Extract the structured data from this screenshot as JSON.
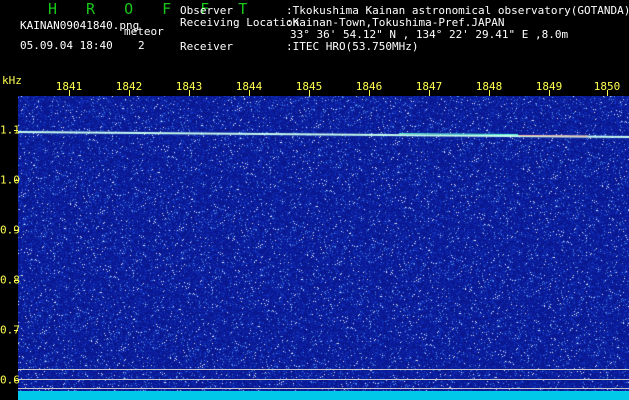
{
  "header": {
    "app_title": "H R O F F T",
    "filename": "KAINAN09041840.png",
    "meteor_label": "meteor",
    "datetime": "05.09.04 18:40",
    "meteor_count": "2",
    "observer_label": "Observer",
    "observer_value": ":Tkokushima Kainan astronomical observatory(GOTANDA)",
    "location_label": "Receiving Location",
    "location_value": ":Kainan-Town,Tokushima-Pref.JAPAN",
    "coordinates": "33° 36' 54.12\" N , 134° 22' 29.41\" E ,8.0m",
    "receiver_label": "Receiver",
    "receiver_value": ":ITEC HRO(53.750MHz)"
  },
  "axis": {
    "unit": "kHz",
    "x_ticks": [
      "1841",
      "1842",
      "1843",
      "1844",
      "1845",
      "1846",
      "1847",
      "1848",
      "1849",
      "1850"
    ],
    "y_ticks": [
      "1.1",
      "1.0",
      "0.9",
      "0.8",
      "0.7",
      "0.6"
    ]
  },
  "colors": {
    "background": "#0a1890",
    "signal_line": "#c8fff0",
    "label": "#ffff50",
    "title": "#18c818"
  }
}
